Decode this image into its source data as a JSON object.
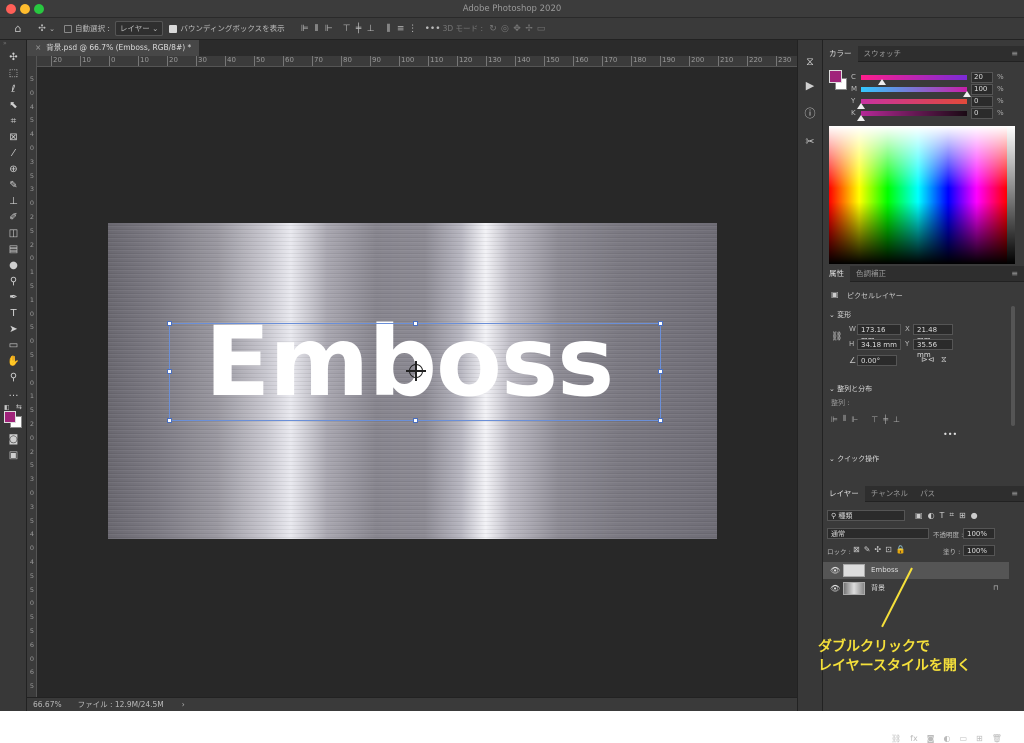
{
  "window": {
    "title": "Adobe Photoshop 2020",
    "close_color": "#ff5f57",
    "min_color": "#ffbd2e",
    "max_color": "#28c840"
  },
  "options_bar": {
    "auto_select_label": "自動選択 :",
    "auto_select_target": "レイヤー",
    "show_bbox_label": "バウンディングボックスを表示",
    "mode_3d_label": "3D モード :"
  },
  "document": {
    "tab_label": "背景.psd @ 66.7% (Emboss, RGB/8#) *"
  },
  "ruler": {
    "h_ticks": [
      "20",
      "10",
      "0",
      "10",
      "20",
      "30",
      "40",
      "50",
      "60",
      "70",
      "80",
      "90",
      "100",
      "110",
      "120",
      "130",
      "140",
      "150",
      "160",
      "170",
      "180",
      "190",
      "200",
      "210",
      "220",
      "230"
    ],
    "v_ticks": [
      "5",
      "0",
      "4",
      "5",
      "4",
      "0",
      "3",
      "5",
      "3",
      "0",
      "2",
      "5",
      "2",
      "0",
      "1",
      "5",
      "1",
      "0",
      "5",
      "0",
      "5",
      "1",
      "0",
      "1",
      "5",
      "2",
      "0",
      "2",
      "5",
      "3",
      "0",
      "3",
      "5",
      "4",
      "0",
      "4",
      "5",
      "5",
      "0",
      "5",
      "5",
      "6",
      "0",
      "6",
      "5"
    ]
  },
  "canvas": {
    "layer_text": "Emboss"
  },
  "status": {
    "zoom": "66.67%",
    "file_info": "ファイル : 12.9M/24.5M"
  },
  "color_panel": {
    "tabs": [
      "カラー",
      "スウォッチ"
    ],
    "sliders": [
      {
        "label": "C",
        "value": "20",
        "unit": "%",
        "fraction": 0.2
      },
      {
        "label": "M",
        "value": "100",
        "unit": "%",
        "fraction": 1.0
      },
      {
        "label": "Y",
        "value": "0",
        "unit": "%",
        "fraction": 0.0
      },
      {
        "label": "K",
        "value": "0",
        "unit": "%",
        "fraction": 0.0
      }
    ],
    "foreground_color": "#a0237a"
  },
  "properties_panel": {
    "tabs": [
      "属性",
      "色調補正"
    ],
    "layer_kind": "ピクセルレイヤー",
    "transform_title": "変形",
    "w_label": "W",
    "w_value": "173.16 mm",
    "x_label": "X",
    "x_value": "21.48 mm",
    "h_label": "H",
    "h_value": "34.18 mm",
    "y_label": "Y",
    "y_value": "35.56 mm",
    "angle_value": "0.00°",
    "align_title": "整列と分布",
    "align_label": "整列 :",
    "quick_title": "クイック操作"
  },
  "layers_panel": {
    "tabs": [
      "レイヤー",
      "チャンネル",
      "パス"
    ],
    "filter_kind": "種類",
    "blend_mode": "通常",
    "opacity_label": "不透明度 :",
    "opacity_value": "100%",
    "lock_label": "ロック :",
    "fill_label": "塗り :",
    "fill_value": "100%",
    "layers": [
      {
        "name": "Emboss",
        "selected": true
      },
      {
        "name": "背景",
        "selected": false
      }
    ]
  },
  "annotation": {
    "line1": "ダブルクリックで",
    "line2": "レイヤースタイルを開く",
    "color": "#f5e03a"
  }
}
